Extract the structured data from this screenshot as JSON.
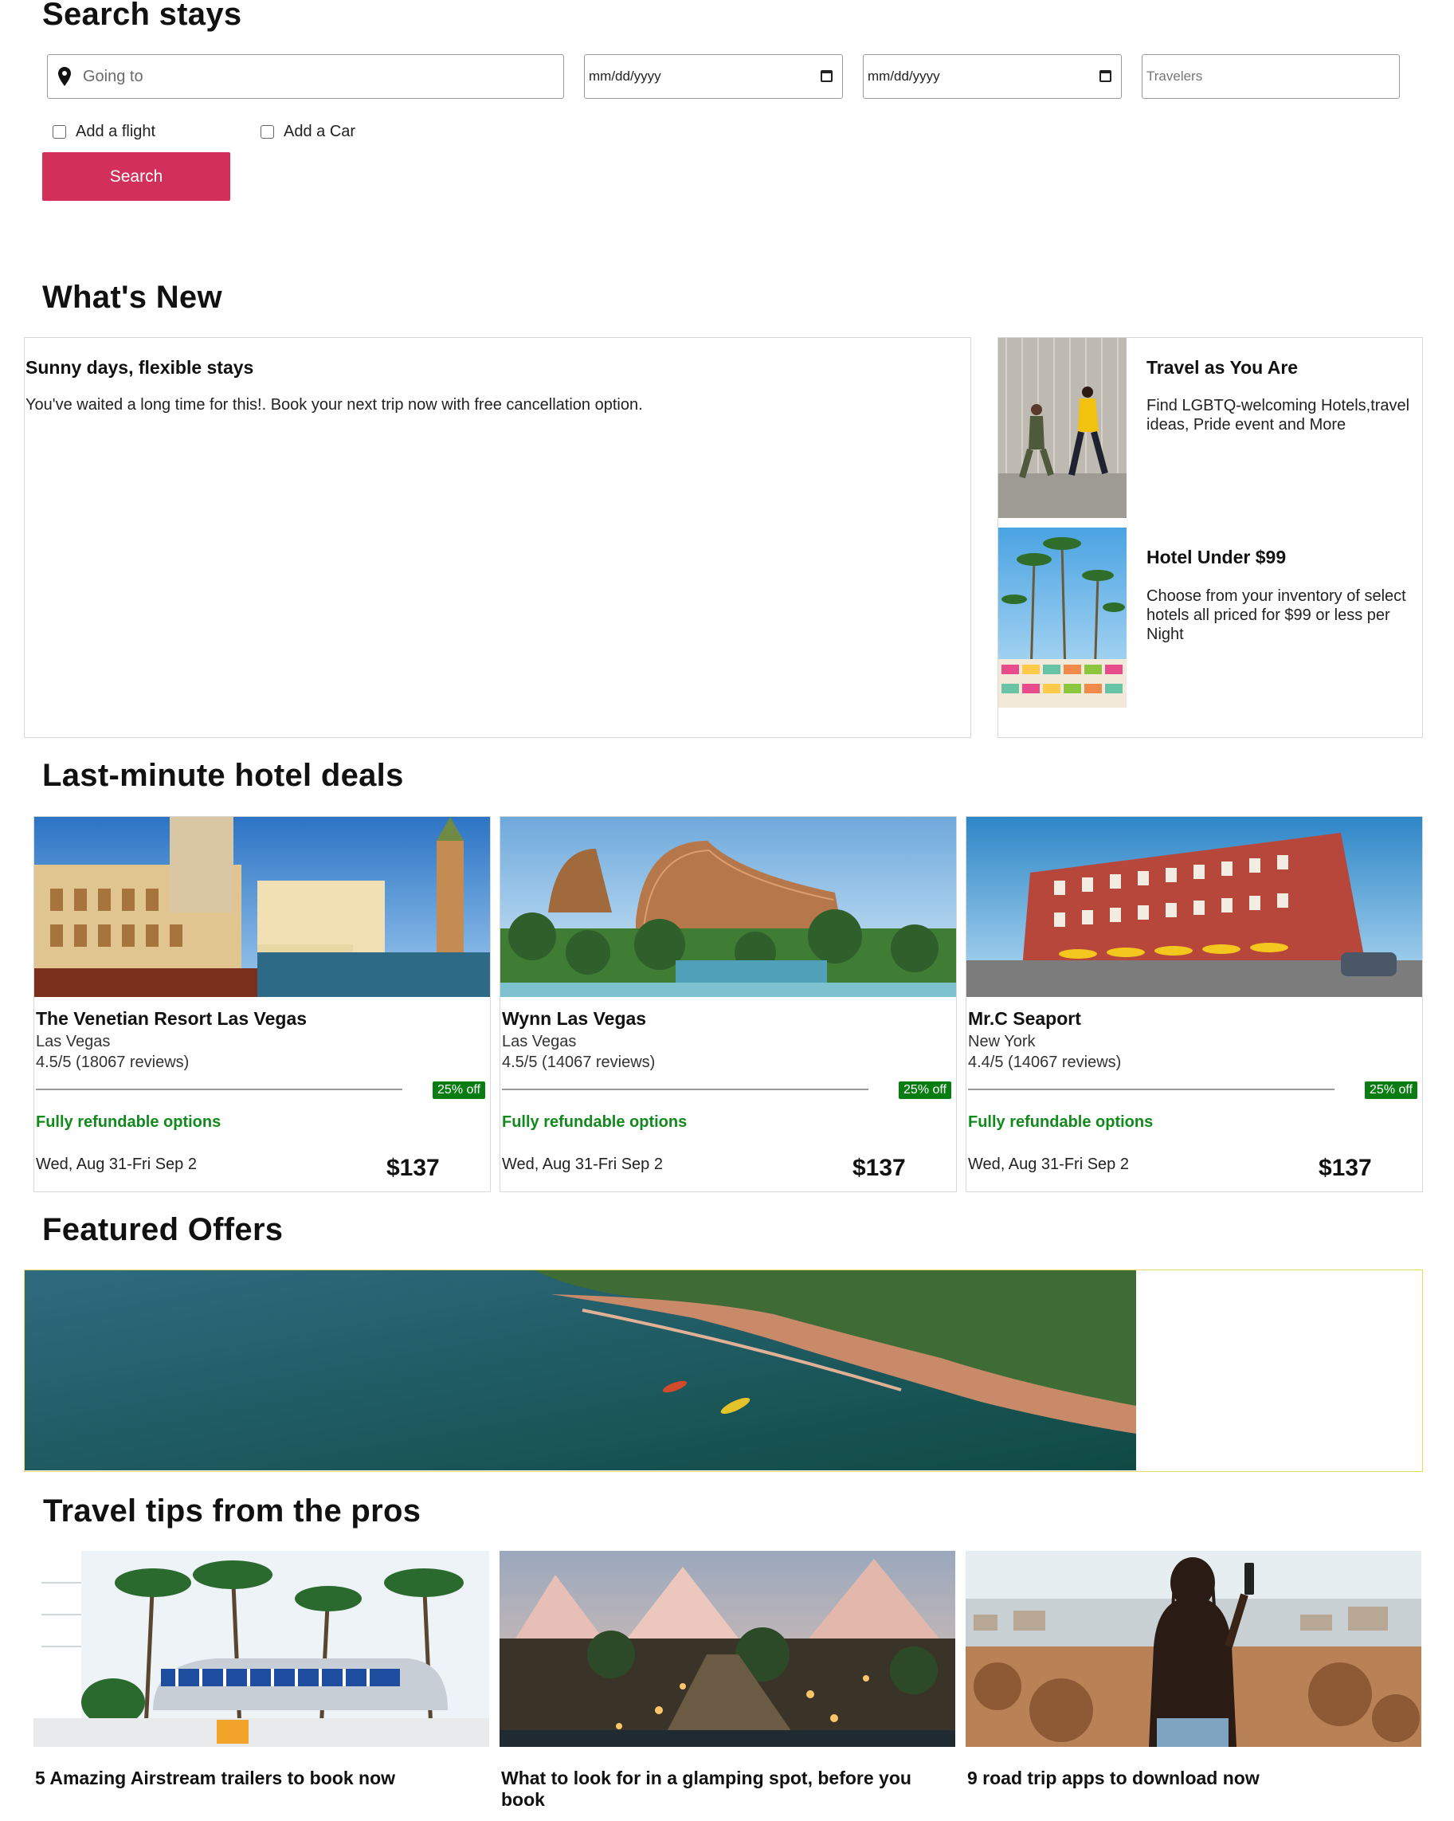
{
  "search": {
    "title": "Search stays",
    "going_to_placeholder": "Going to",
    "checkin_placeholder": "mm/dd/yyyy",
    "checkout_placeholder": "mm/dd/yyyy",
    "travelers_placeholder": "Travelers",
    "add_flight_label": "Add a flight",
    "add_car_label": "Add a Car",
    "search_button": "Search"
  },
  "whats_new": {
    "title": "What's New",
    "main": {
      "title": "Sunny days, flexible stays",
      "text": "You've waited a long time for this!. Book your next trip now with free cancellation option."
    },
    "side": [
      {
        "title": "Travel as You Are",
        "text": "Find LGBTQ-welcoming Hotels,travel ideas, Pride event and More"
      },
      {
        "title": "Hotel Under $99",
        "text": "Choose from your inventory of select hotels all priced for $99 or less per Night"
      }
    ]
  },
  "deals": {
    "title": "Last-minute hotel deals",
    "hotels": [
      {
        "name": "The Venetian Resort Las Vegas",
        "city": "Las Vegas",
        "rating": "4.5/5 (18067 reviews)",
        "badge": "25% off",
        "refund": "Fully refundable options",
        "dates": "Wed, Aug 31-Fri Sep 2",
        "price": "$137"
      },
      {
        "name": "Wynn Las Vegas",
        "city": "Las Vegas",
        "rating": "4.5/5 (14067 reviews)",
        "badge": "25% off",
        "refund": "Fully refundable options",
        "dates": "Wed, Aug 31-Fri Sep 2",
        "price": "$137"
      },
      {
        "name": "Mr.C Seaport",
        "city": "New York",
        "rating": "4.4/5 (14067 reviews)",
        "badge": "25% off",
        "refund": "Fully refundable options",
        "dates": "Wed, Aug 31-Fri Sep 2",
        "price": "$137"
      }
    ]
  },
  "featured": {
    "title": "Featured Offers"
  },
  "tips": {
    "title": "Travel tips from the pros",
    "items": [
      {
        "title": "5 Amazing Airstream trailers to book now"
      },
      {
        "title": "What to look for in a glamping spot, before you book"
      },
      {
        "title": "9 road trip apps to download now"
      }
    ]
  },
  "colors": {
    "accent": "#d2305a",
    "discount_badge": "#0a7d12",
    "refund_text": "#118a1c",
    "featured_border": "#e8dc60"
  }
}
